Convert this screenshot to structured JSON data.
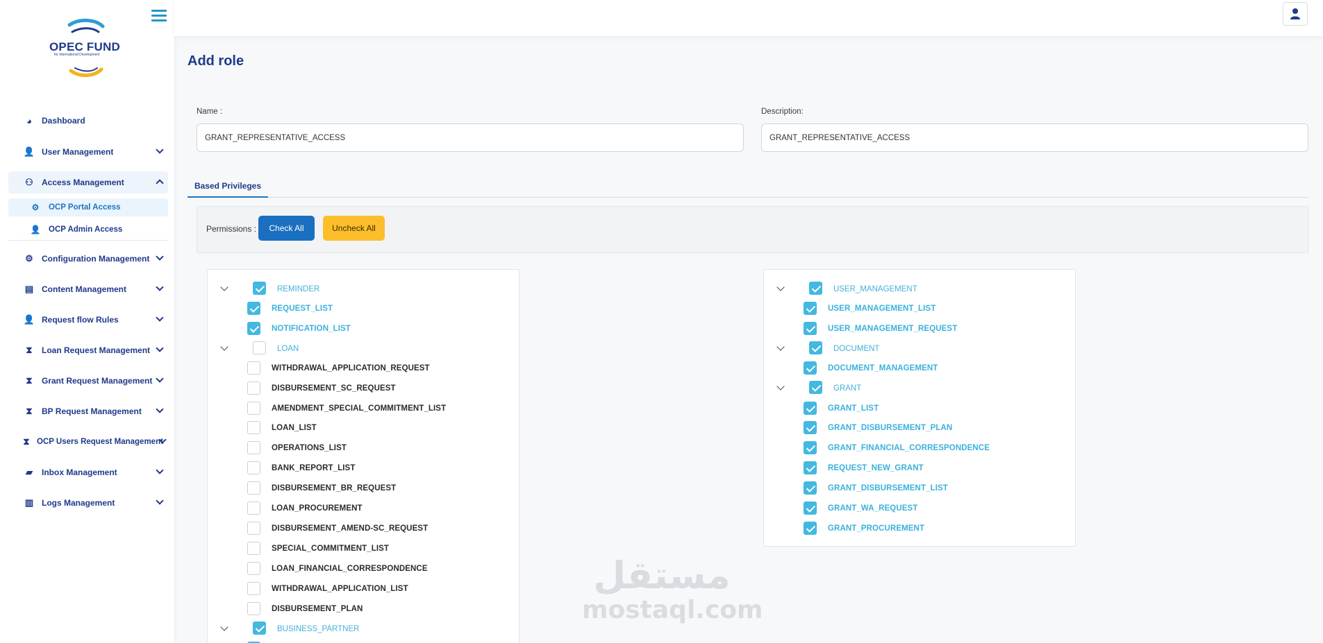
{
  "brand": {
    "name": "OPEC FUND",
    "tagline": "for International Development"
  },
  "sidebar": {
    "items": [
      {
        "label": "Dashboard",
        "icon": "dashboard-icon"
      },
      {
        "label": "User Management",
        "icon": "user-gear-icon"
      },
      {
        "label": "Access Management",
        "icon": "sitemap-icon",
        "expanded": true
      },
      {
        "label": "Configuration Management",
        "icon": "gear-icon"
      },
      {
        "label": "Content Management",
        "icon": "document-icon"
      },
      {
        "label": "Request flow Rules",
        "icon": "user-arrow-icon"
      },
      {
        "label": "Loan Request Management",
        "icon": "hourglass-icon"
      },
      {
        "label": "Grant Request Management",
        "icon": "hourglass-icon"
      },
      {
        "label": "BP Request Management",
        "icon": "hourglass-icon"
      },
      {
        "label": "OCP Users Request Management",
        "icon": "hourglass-icon"
      },
      {
        "label": "Inbox Management",
        "icon": "message-icon"
      },
      {
        "label": "Logs Management",
        "icon": "chart-icon"
      }
    ],
    "sub_items": [
      {
        "label": "OCP Portal Access",
        "icon": "gears-icon",
        "active": true
      },
      {
        "label": "OCP Admin Access",
        "icon": "user-icon"
      }
    ]
  },
  "page": {
    "title": "Add role"
  },
  "form": {
    "name_label": "Name :",
    "name_value": "GRANT_REPRESENTATIVE_ACCESS",
    "description_label": "Description:",
    "description_value": "GRANT_REPRESENTATIVE_ACCESS"
  },
  "tabs": [
    {
      "label": "Based Privileges"
    }
  ],
  "permissions": {
    "label": "Permissions :",
    "check_all": "Check All",
    "uncheck_all": "Uncheck All"
  },
  "tree_left": [
    {
      "label": "REMINDER",
      "checked": true,
      "children": [
        {
          "label": "REQUEST_LIST",
          "checked": true
        },
        {
          "label": "NOTIFICATION_LIST",
          "checked": true
        }
      ]
    },
    {
      "label": "LOAN",
      "checked": false,
      "children": [
        {
          "label": "WITHDRAWAL_APPLICATION_REQUEST",
          "checked": false
        },
        {
          "label": "DISBURSEMENT_SC_REQUEST",
          "checked": false
        },
        {
          "label": "AMENDMENT_SPECIAL_COMMITMENT_LIST",
          "checked": false
        },
        {
          "label": "LOAN_LIST",
          "checked": false
        },
        {
          "label": "OPERATIONS_LIST",
          "checked": false
        },
        {
          "label": "BANK_REPORT_LIST",
          "checked": false
        },
        {
          "label": "DISBURSEMENT_BR_REQUEST",
          "checked": false
        },
        {
          "label": "LOAN_PROCUREMENT",
          "checked": false
        },
        {
          "label": "DISBURSEMENT_AMEND-SC_REQUEST",
          "checked": false
        },
        {
          "label": "SPECIAL_COMMITMENT_LIST",
          "checked": false
        },
        {
          "label": "LOAN_FINANCIAL_CORRESPONDENCE",
          "checked": false
        },
        {
          "label": "WITHDRAWAL_APPLICATION_LIST",
          "checked": false
        },
        {
          "label": "DISBURSEMENT_PLAN",
          "checked": false
        }
      ]
    },
    {
      "label": "BUSINESS_PARTNER",
      "checked": true,
      "children": []
    }
  ],
  "tree_right": [
    {
      "label": "USER_MANAGEMENT",
      "checked": true,
      "children": [
        {
          "label": "USER_MANAGEMENT_LIST",
          "checked": true
        },
        {
          "label": "USER_MANAGEMENT_REQUEST",
          "checked": true
        }
      ]
    },
    {
      "label": "DOCUMENT",
      "checked": true,
      "children": [
        {
          "label": "DOCUMENT_MANAGEMENT",
          "checked": true
        }
      ]
    },
    {
      "label": "GRANT",
      "checked": true,
      "children": [
        {
          "label": "GRANT_LIST",
          "checked": true
        },
        {
          "label": "GRANT_DISBURSEMENT_PLAN",
          "checked": true
        },
        {
          "label": "GRANT_FINANCIAL_CORRESPONDENCE",
          "checked": true
        },
        {
          "label": "REQUEST_NEW_GRANT",
          "checked": true
        },
        {
          "label": "GRANT_DISBURSEMENT_LIST",
          "checked": true
        },
        {
          "label": "GRANT_WA_REQUEST",
          "checked": true
        },
        {
          "label": "GRANT_PROCUREMENT",
          "checked": true
        }
      ]
    }
  ],
  "watermark": {
    "arabic": "مستقل",
    "latin": "mostaql.com"
  },
  "colors": {
    "primary": "#1e3a8a",
    "accent": "#43b8e0",
    "button_primary": "#1b6fc0",
    "button_warning": "#fcbf2b"
  }
}
